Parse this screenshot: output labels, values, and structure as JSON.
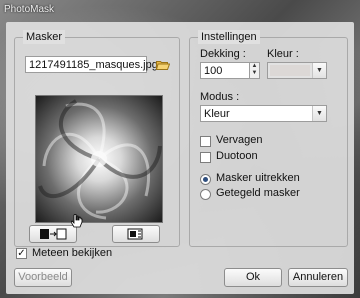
{
  "window": {
    "title": "PhotoMask"
  },
  "masker": {
    "legend": "Masker",
    "filename": "1217491185_masques.jpg",
    "preview_alt": "Mask preview"
  },
  "settings": {
    "legend": "Instellingen",
    "dekking_label": "Dekking :",
    "dekking_value": "100",
    "kleur_label": "Kleur :",
    "modus_label": "Modus :",
    "modus_value": "Kleur",
    "vervagen_label": "Vervagen",
    "duotoon_label": "Duotoon",
    "masker_uitrekken_label": "Masker uitrekken",
    "getegeld_masker_label": "Getegeld masker"
  },
  "footer": {
    "meteen_bekijken_label": "Meteen bekijken",
    "voorbeeld_label": "Voorbeeld",
    "ok_label": "Ok",
    "annuleren_label": "Annuleren"
  },
  "state": {
    "vervagen": false,
    "duotoon": false,
    "masker_mode": "Masker uitrekken",
    "meteen_bekijken": true
  }
}
